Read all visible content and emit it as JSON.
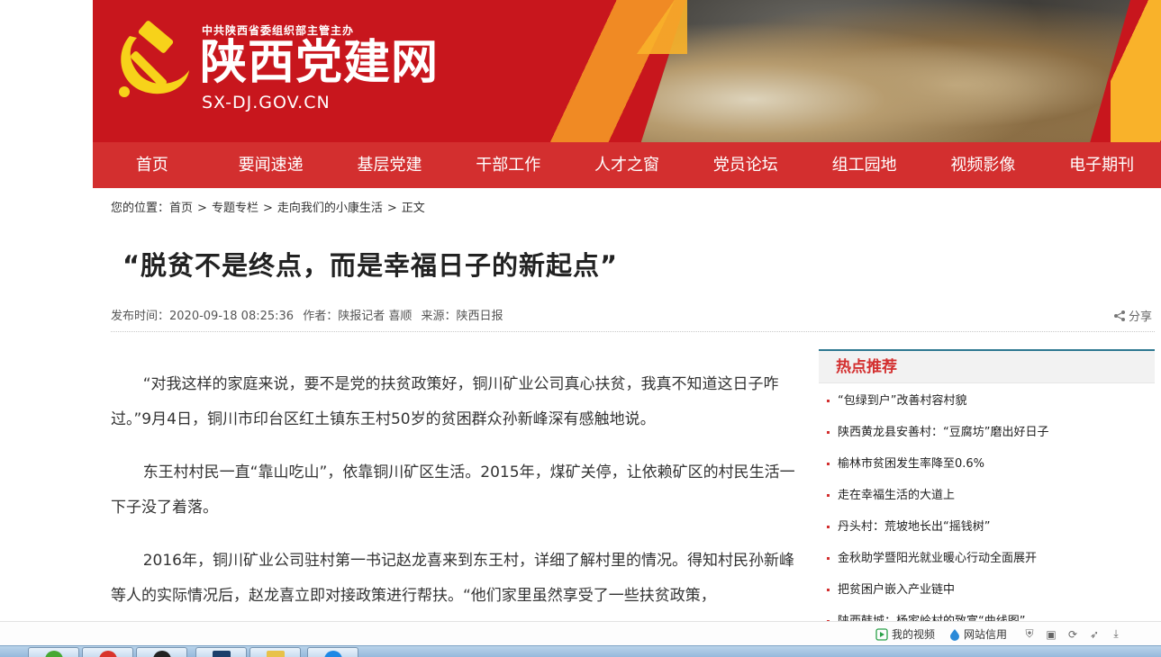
{
  "header": {
    "subtitle": "中共陕西省委组织部主管主办",
    "site_name": "陕西党建网",
    "domain": "SX-DJ.GOV.CN"
  },
  "nav": {
    "items": [
      "首页",
      "要闻速递",
      "基层党建",
      "干部工作",
      "人才之窗",
      "党员论坛",
      "组工园地",
      "视频影像",
      "电子期刊"
    ]
  },
  "breadcrumb": {
    "prefix": "您的位置：",
    "items": [
      "首页",
      "专题专栏",
      "走向我们的小康生活",
      "正文"
    ],
    "separator": ">"
  },
  "article": {
    "title": "“脱贫不是终点，而是幸福日子的新起点”",
    "publish_time": "发布时间：2020-09-18 08:25:36",
    "author": "作者：陕报记者 喜顺",
    "source": "来源：陕西日报",
    "share_label": "分享",
    "paragraphs": [
      "“对我这样的家庭来说，要不是党的扶贫政策好，铜川矿业公司真心扶贫，我真不知道这日子咋过。”9月4日，铜川市印台区红土镇东王村50岁的贫困群众孙新峰深有感触地说。",
      "东王村村民一直“靠山吃山”，依靠铜川矿区生活。2015年，煤矿关停，让依赖矿区的村民生活一下子没了着落。",
      "2016年，铜川矿业公司驻村第一书记赵龙喜来到东王村，详细了解村里的情况。得知村民孙新峰等人的实际情况后，赵龙喜立即对接政策进行帮扶。“他们家里虽然享受了一些扶贫政策，"
    ]
  },
  "hot": {
    "title": "热点推荐",
    "items": [
      "“包绿到户”改善村容村貌",
      "陕西黄龙县安善村：“豆腐坊”磨出好日子",
      "榆林市贫困发生率降至0.6%",
      "走在幸福生活的大道上",
      "丹头村：荒坡地长出“摇钱树”",
      "金秋助学暨阳光就业暖心行动全面展开",
      "把贫困户嵌入产业链中",
      "陕西韩城：杨家岭村的致富“曲线图”"
    ]
  },
  "statusbar": {
    "video_label": "我的视频",
    "credit_label": "网站信用"
  },
  "colors": {
    "banner_red": "#c8161d",
    "nav_red": "#d32f2f",
    "hot_title": "#d32f2f",
    "hot_border": "#2d7891"
  },
  "icons": {
    "share": "share-icon",
    "video": "play-icon",
    "credit": "drop-icon",
    "shield": "shield-icon",
    "image": "image-icon",
    "refresh": "refresh-icon",
    "rocket": "rocket-icon",
    "download": "download-icon"
  }
}
